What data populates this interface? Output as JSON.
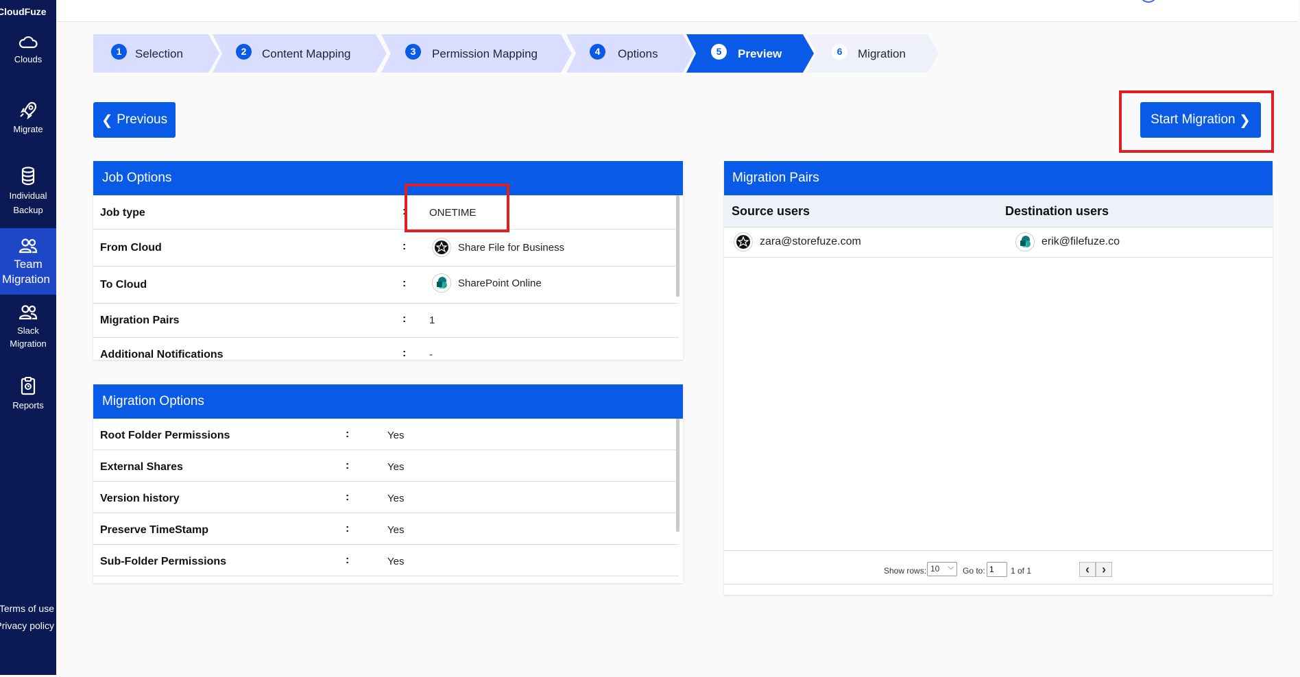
{
  "app": {
    "brand": "CloudFuze"
  },
  "sidebar": {
    "items": [
      {
        "label": "Clouds"
      },
      {
        "label": "Migrate"
      },
      {
        "label_line1": "Individual",
        "label_line2": "Backup"
      },
      {
        "label_line1": "Team",
        "label_line2": "Migration"
      },
      {
        "label_line1": "Slack",
        "label_line2": "Migration"
      },
      {
        "label": "Reports"
      }
    ],
    "footer": {
      "terms": "Terms of use",
      "privacy": "Privacy policy"
    }
  },
  "stepper": {
    "steps": [
      {
        "num": "1",
        "label": "Selection"
      },
      {
        "num": "2",
        "label": "Content Mapping"
      },
      {
        "num": "3",
        "label": "Permission Mapping"
      },
      {
        "num": "4",
        "label": "Options"
      },
      {
        "num": "5",
        "label": "Preview"
      },
      {
        "num": "6",
        "label": "Migration"
      }
    ],
    "active_step": "5"
  },
  "actions": {
    "previous": "Previous",
    "start": "Start Migration"
  },
  "job_options": {
    "title": "Job Options",
    "separator": ":",
    "rows": [
      {
        "key": "Job type",
        "value": "ONETIME"
      },
      {
        "key": "From Cloud",
        "value": "Share File for Business"
      },
      {
        "key": "To Cloud",
        "value": "SharePoint Online"
      },
      {
        "key": "Migration Pairs",
        "value": "1"
      },
      {
        "key": "Additional Notifications",
        "value": "-"
      }
    ]
  },
  "migration_options": {
    "title": "Migration Options",
    "separator": ":",
    "rows": [
      {
        "key": "Root Folder Permissions",
        "value": "Yes"
      },
      {
        "key": "External Shares",
        "value": "Yes"
      },
      {
        "key": "Version history",
        "value": "Yes"
      },
      {
        "key": "Preserve TimeStamp",
        "value": "Yes"
      },
      {
        "key": "Sub-Folder Permissions",
        "value": "Yes"
      }
    ]
  },
  "migration_pairs": {
    "title": "Migration Pairs",
    "columns": [
      "Source users",
      "Destination users"
    ],
    "rows": [
      {
        "source": "zara@storefuze.com",
        "destination": "erik@filefuze.co"
      }
    ],
    "pager": {
      "show_rows_label": "Show rows:",
      "rows_value": "10",
      "goto_label": "Go to:",
      "goto_value": "1",
      "page_info": "1 of 1"
    }
  },
  "colors": {
    "primary": "#0a5ae8",
    "sidebar": "#0b1a55",
    "sidebar_active": "#1e47c7",
    "highlight": "#e02020",
    "step_inactive": "#d9deff"
  }
}
